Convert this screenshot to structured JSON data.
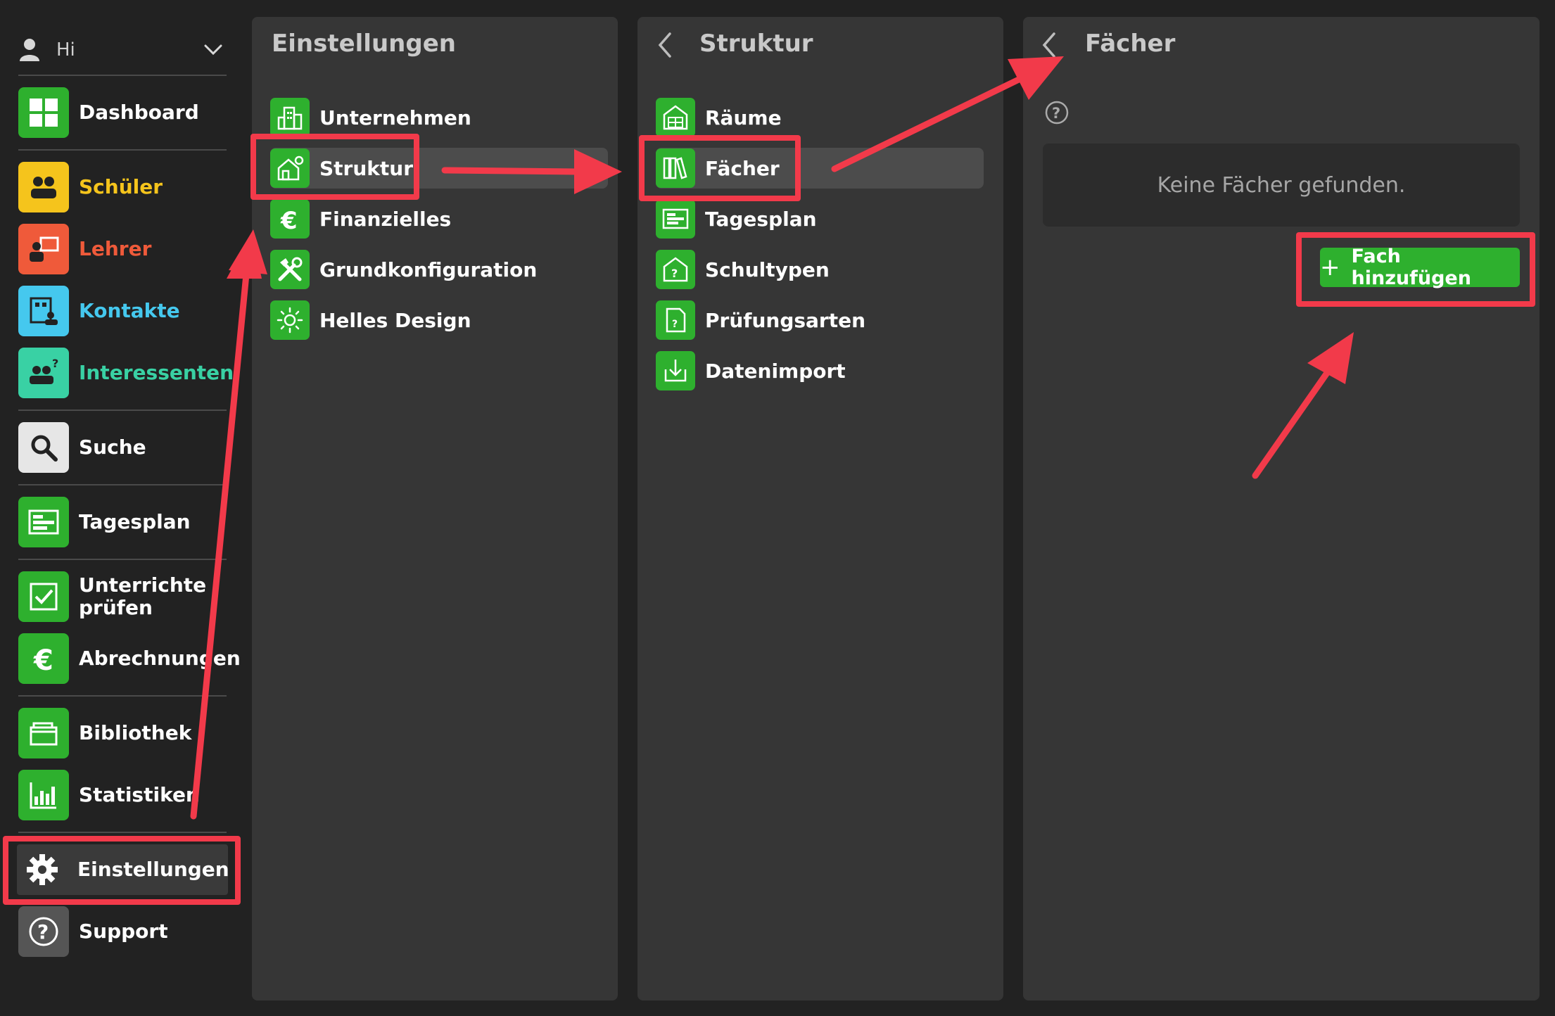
{
  "colors": {
    "background": "#222222",
    "panel": "#363636",
    "accent_green": "#2eb02e",
    "annotation_red": "#f23a4a"
  },
  "user": {
    "name": "Hi",
    "icon": "user-icon"
  },
  "sidebar": {
    "items": [
      {
        "label": "Dashboard",
        "icon": "dashboard-icon",
        "color": "#ffffff",
        "icon_bg": "#2eb02e"
      },
      {
        "label": "Schüler",
        "icon": "students-icon",
        "color": "#f5c41c",
        "icon_bg": "#f5c41c"
      },
      {
        "label": "Lehrer",
        "icon": "teacher-icon",
        "color": "#ef5a3a",
        "icon_bg": "#ef5a3a"
      },
      {
        "label": "Kontakte",
        "icon": "contacts-icon",
        "color": "#45c8ee",
        "icon_bg": "#45c8ee"
      },
      {
        "label": "Interessenten",
        "icon": "prospects-icon",
        "color": "#39d1a4",
        "icon_bg": "#39d1a4"
      },
      {
        "label": "Suche",
        "icon": "search-icon",
        "color": "#ffffff",
        "icon_bg": "#e6e6e6"
      },
      {
        "label": "Tagesplan",
        "icon": "dayplan-icon",
        "color": "#ffffff",
        "icon_bg": "#2eb02e"
      },
      {
        "label": "Unterrichte prüfen",
        "icon": "checkbox-icon",
        "color": "#ffffff",
        "icon_bg": "#2eb02e"
      },
      {
        "label": "Abrechnungen",
        "icon": "euro-icon",
        "color": "#ffffff",
        "icon_bg": "#2eb02e"
      },
      {
        "label": "Bibliothek",
        "icon": "library-icon",
        "color": "#ffffff",
        "icon_bg": "#2eb02e"
      },
      {
        "label": "Statistiken",
        "icon": "statistics-icon",
        "color": "#ffffff",
        "icon_bg": "#2eb02e"
      },
      {
        "label": "Einstellungen",
        "icon": "gear-icon",
        "color": "#ffffff",
        "icon_bg": "#3a3a3a"
      },
      {
        "label": "Support",
        "icon": "help-icon",
        "color": "#ffffff",
        "icon_bg": "#555555"
      }
    ],
    "active": "Einstellungen"
  },
  "settings_panel": {
    "title": "Einstellungen",
    "items": [
      {
        "label": "Unternehmen",
        "icon": "building-icon"
      },
      {
        "label": "Struktur",
        "icon": "house-gear-icon"
      },
      {
        "label": "Finanzielles",
        "icon": "euro-icon"
      },
      {
        "label": "Grundkonfiguration",
        "icon": "tools-icon"
      },
      {
        "label": "Helles Design",
        "icon": "sun-icon"
      }
    ],
    "selected": "Struktur"
  },
  "structure_panel": {
    "title": "Struktur",
    "items": [
      {
        "label": "Räume",
        "icon": "rooms-icon"
      },
      {
        "label": "Fächer",
        "icon": "books-icon"
      },
      {
        "label": "Tagesplan",
        "icon": "dayplan-icon"
      },
      {
        "label": "Schultypen",
        "icon": "school-type-icon"
      },
      {
        "label": "Prüfungsarten",
        "icon": "exam-icon"
      },
      {
        "label": "Datenimport",
        "icon": "import-icon"
      }
    ],
    "selected": "Fächer"
  },
  "subjects_panel": {
    "title": "Fächer",
    "empty_text": "Keine Fächer gefunden.",
    "add_button": {
      "plus": "+",
      "label": "Fach hinzufügen"
    }
  }
}
